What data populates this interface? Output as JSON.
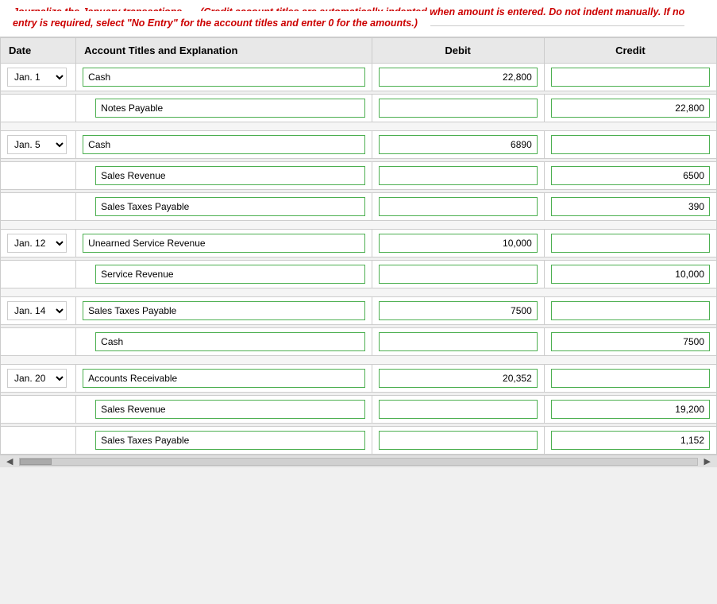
{
  "instruction": {
    "text": "Journalize the January transactions. ",
    "italic_part": "(Credit account titles are automatically indented when amount is entered. Do not indent manually. If no entry is required, select \"No Entry\" for the account titles and enter 0 for the amounts.)"
  },
  "table": {
    "headers": {
      "date": "Date",
      "account": "Account Titles and Explanation",
      "debit": "Debit",
      "credit": "Credit"
    },
    "rows": [
      {
        "date": "Jan. 1",
        "account": "Cash",
        "debit": "22,800",
        "credit": "",
        "indent": false
      },
      {
        "date": "",
        "account": "Notes Payable",
        "debit": "",
        "credit": "22,800",
        "indent": true
      },
      {
        "date": "Jan. 5",
        "account": "Cash",
        "debit": "6890",
        "credit": "",
        "indent": false
      },
      {
        "date": "",
        "account": "Sales Revenue",
        "debit": "",
        "credit": "6500",
        "indent": true
      },
      {
        "date": "",
        "account": "Sales Taxes Payable",
        "debit": "",
        "credit": "390",
        "indent": true
      },
      {
        "date": "Jan. 12",
        "account": "Unearned Service Revenue",
        "debit": "10,000",
        "credit": "",
        "indent": false
      },
      {
        "date": "",
        "account": "Service Revenue",
        "debit": "",
        "credit": "10,000",
        "indent": true
      },
      {
        "date": "Jan. 14",
        "account": "Sales Taxes Payable",
        "debit": "7500",
        "credit": "",
        "indent": false
      },
      {
        "date": "",
        "account": "Cash",
        "debit": "",
        "credit": "7500",
        "indent": true
      },
      {
        "date": "Jan. 20",
        "account": "Accounts Receivable",
        "debit": "20,352",
        "credit": "",
        "indent": false
      },
      {
        "date": "",
        "account": "Sales Revenue",
        "debit": "",
        "credit": "19,200",
        "indent": true
      },
      {
        "date": "",
        "account": "Sales Taxes Payable",
        "debit": "",
        "credit": "1,152",
        "indent": true
      }
    ],
    "date_options": [
      "Jan. 1",
      "Jan. 5",
      "Jan. 12",
      "Jan. 14",
      "Jan. 20"
    ]
  }
}
